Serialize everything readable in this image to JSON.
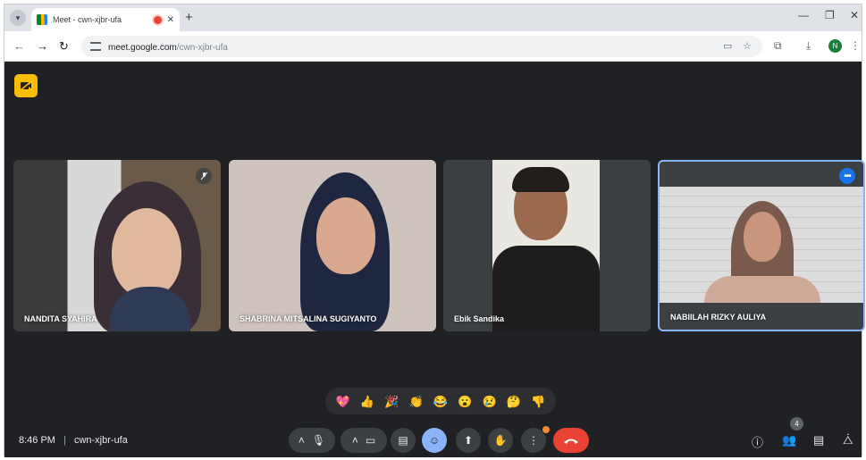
{
  "browser": {
    "tab": {
      "title": "Meet - cwn-xjbr-ufa"
    },
    "address": {
      "host": "meet.google.com",
      "path": "/cwn-xjbr-ufa"
    },
    "profile_initial": "N"
  },
  "meet": {
    "participants": [
      {
        "name": "NANDITA SYAHIRA",
        "muted": true
      },
      {
        "name": "SHABRINA MITSALINA SUGIYANTO",
        "muted": false
      },
      {
        "name": "Ebik Sandika",
        "muted": false
      },
      {
        "name": "NABIILAH RIZKY AULIYA",
        "pinned_menu": true
      }
    ],
    "reactions": [
      "💖",
      "👍",
      "🎉",
      "👏",
      "😂",
      "😮",
      "😢",
      "🤔",
      "👎"
    ],
    "footer": {
      "time": "8:46 PM",
      "separator": "|",
      "meeting_code": "cwn-xjbr-ufa",
      "people_count": "4"
    },
    "colors": {
      "end_call": "#ea4335",
      "active_control": "#8ab4f8",
      "highlight_border": "#8ab4f8",
      "camera_off_badge": "#fbbc04"
    }
  }
}
